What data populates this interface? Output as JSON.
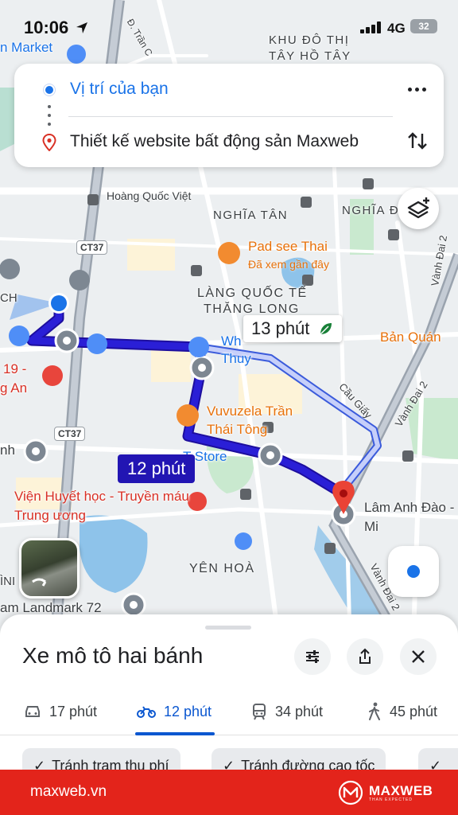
{
  "status_bar": {
    "time": "10:06",
    "network": "4G",
    "battery": "32"
  },
  "directions": {
    "origin": "Vị trí của bạn",
    "destination": "Thiết kế website bất động sản Maxweb"
  },
  "map": {
    "area_labels": [
      "KHU ĐÔ THỊ",
      "TÂY HỒ TÂY",
      "NGHĨA TÂN",
      "NGHĨA Đ",
      "LÀNG QUỐC TẾ",
      "THĂNG LONG",
      "YÊN HOÀ"
    ],
    "street_labels": [
      "Hoàng Quốc Việt",
      "Cầu Giấy",
      "Vành Đai 2",
      "Vành Đai 2",
      "Vành Đai 2",
      "Đ. Trần C"
    ],
    "road_shields": [
      "CT37",
      "CT37"
    ],
    "pois": [
      {
        "name": "Pad see Thai",
        "note": "Đã xem gần đây"
      },
      {
        "name": "Vuvuzela Trần Thái Tông"
      },
      {
        "name": "Viện Huyết học - Truyền máu Trung ương"
      },
      {
        "name": "Lâm Anh Đào -Mi"
      },
      {
        "name": "Bản Quán"
      },
      {
        "name": "n Market"
      },
      {
        "name": "am Landmark 72"
      },
      {
        "name": "Wh Thuy"
      },
      {
        "name": "T Store"
      }
    ],
    "edge_fragments": [
      "CH",
      "19 -",
      "g An",
      "nh",
      "ÌNI"
    ],
    "eta_alternate": "13 phút",
    "eta_selected": "12 phút",
    "colors": {
      "route_main": "#2a1fd6",
      "route_alt": "#a8b4f8",
      "origin": "#1a73e8",
      "pin": "#ea4335"
    }
  },
  "sheet": {
    "title": "Xe mô tô hai bánh",
    "modes": [
      {
        "icon": "car-icon",
        "label": "17 phút"
      },
      {
        "icon": "motorbike-icon",
        "label": "12 phút"
      },
      {
        "icon": "transit-icon",
        "label": "34 phút"
      },
      {
        "icon": "walk-icon",
        "label": "45 phút"
      }
    ],
    "chips": [
      "Tránh trạm thu phí",
      "Tránh đường cao tốc"
    ]
  },
  "footer": {
    "site": "maxweb.vn",
    "brand": "MAXWEB",
    "tagline": "THAN EXPECTED"
  }
}
